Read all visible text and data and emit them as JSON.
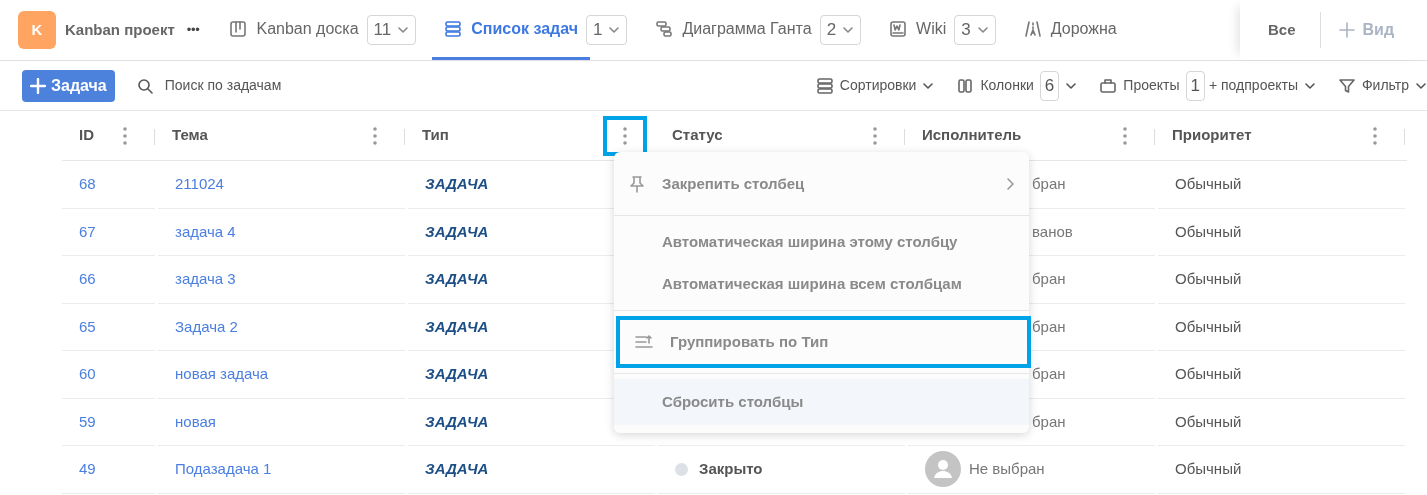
{
  "project": {
    "initial": "K",
    "name": "Kanban проект",
    "more": "•••"
  },
  "tabs": [
    {
      "label": "Kanban доска",
      "count": "11",
      "selected": false
    },
    {
      "label": "Список задач",
      "count": "1",
      "selected": true
    },
    {
      "label": "Диаграмма Ганта",
      "count": "2",
      "selected": false
    },
    {
      "label": "Wiki",
      "count": "3",
      "selected": false
    },
    {
      "label": "Дорожна",
      "selected": false
    }
  ],
  "tab_actions": {
    "all": "Все",
    "add_view": "Вид"
  },
  "toolbar": {
    "new_task": "Задача",
    "search_placeholder": "Поиск по задачам",
    "sort": "Сортировки",
    "columns": "Колонки",
    "columns_count": "6",
    "projects": "Проекты",
    "projects_count": "1",
    "subprojects": "+ подпроекты",
    "filter": "Фильтр"
  },
  "table": {
    "columns": [
      {
        "label": "ID",
        "menu_open": false
      },
      {
        "label": "Тема",
        "menu_open": false
      },
      {
        "label": "Тип",
        "menu_open": true
      },
      {
        "label": "Статус",
        "menu_open": false
      },
      {
        "label": "Исполнитель",
        "menu_open": false
      },
      {
        "label": "Приоритет",
        "menu_open": false
      }
    ],
    "rows": [
      {
        "kind": "covered",
        "id": "68",
        "subject": "211024",
        "type": "ЗАДАЧА",
        "assignee": "бран",
        "priority": "Обычный"
      },
      {
        "kind": "covered",
        "id": "67",
        "subject": "задача 4",
        "type": "ЗАДАЧА",
        "assignee": "ванов",
        "priority": "Обычный"
      },
      {
        "kind": "covered",
        "id": "66",
        "subject": "задача 3",
        "type": "ЗАДАЧА",
        "assignee": "бран",
        "priority": "Обычный"
      },
      {
        "kind": "covered",
        "id": "65",
        "subject": "Задача 2",
        "type": "ЗАДАЧА",
        "assignee": "бран",
        "priority": "Обычный"
      },
      {
        "kind": "covered",
        "id": "60",
        "subject": "новая задача",
        "type": "ЗАДАЧА",
        "assignee": "бран",
        "priority": "Обычный"
      },
      {
        "kind": "covered",
        "id": "59",
        "subject": "новая",
        "type": "ЗАДАЧА",
        "assignee": "бран",
        "priority": "Обычный"
      },
      {
        "kind": "full",
        "id": "49",
        "subject": "Подазадача 1",
        "type": "ЗАДАЧА",
        "status": "Закрыто",
        "color": "#dde0e6",
        "assignee": "Не выбран",
        "priority": "Обычный"
      }
    ]
  },
  "column_menu": {
    "items": [
      {
        "kind": "submenu",
        "label": "Закрепить столбец",
        "highlighted": false
      },
      {
        "kind": "divider"
      },
      {
        "kind": "plain",
        "label": "Автоматическая ширина этому столбцу",
        "highlighted": false
      },
      {
        "kind": "plain",
        "label": "Автоматическая ширина всем столбцам",
        "highlighted": false
      },
      {
        "kind": "divider"
      },
      {
        "kind": "group",
        "label": "Группировать по Тип",
        "highlighted": true
      },
      {
        "kind": "divider"
      },
      {
        "kind": "hover",
        "label": "Сбросить столбцы",
        "highlighted": false
      }
    ]
  }
}
